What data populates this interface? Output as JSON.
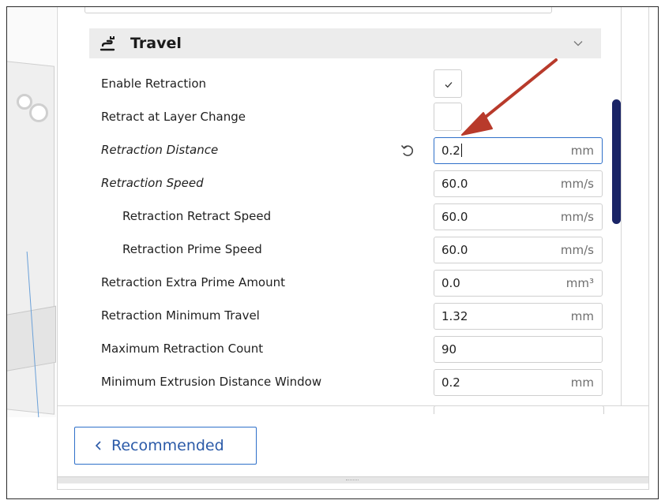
{
  "section": {
    "title": "Travel",
    "icon": "travel-icon",
    "expanded": true
  },
  "settings": [
    {
      "label": "Enable Retraction",
      "type": "checkbox",
      "checked": true
    },
    {
      "label": "Retract at Layer Change",
      "type": "checkbox",
      "checked": false
    },
    {
      "label": "Retraction Distance",
      "type": "input",
      "value": "0.2",
      "unit": "mm",
      "italic": true,
      "has_reset": true,
      "focused": true
    },
    {
      "label": "Retraction Speed",
      "type": "input",
      "value": "60.0",
      "unit": "mm/s",
      "italic": true
    },
    {
      "label": "Retraction Retract Speed",
      "type": "input",
      "value": "60.0",
      "unit": "mm/s",
      "indent": true
    },
    {
      "label": "Retraction Prime Speed",
      "type": "input",
      "value": "60.0",
      "unit": "mm/s",
      "indent": true
    },
    {
      "label": "Retraction Extra Prime Amount",
      "type": "input",
      "value": "0.0",
      "unit": "mm³"
    },
    {
      "label": "Retraction Minimum Travel",
      "type": "input",
      "value": "1.32",
      "unit": "mm"
    },
    {
      "label": "Maximum Retraction Count",
      "type": "input",
      "value": "90",
      "unit": ""
    },
    {
      "label": "Minimum Extrusion Distance Window",
      "type": "input",
      "value": "0.2",
      "unit": "mm"
    }
  ],
  "footer": {
    "recommended_label": "Recommended"
  },
  "colors": {
    "accent": "#2f70c9",
    "scrollbar": "#1a2466",
    "annotation_arrow": "#b83a2b",
    "section_bg": "#ececec"
  }
}
